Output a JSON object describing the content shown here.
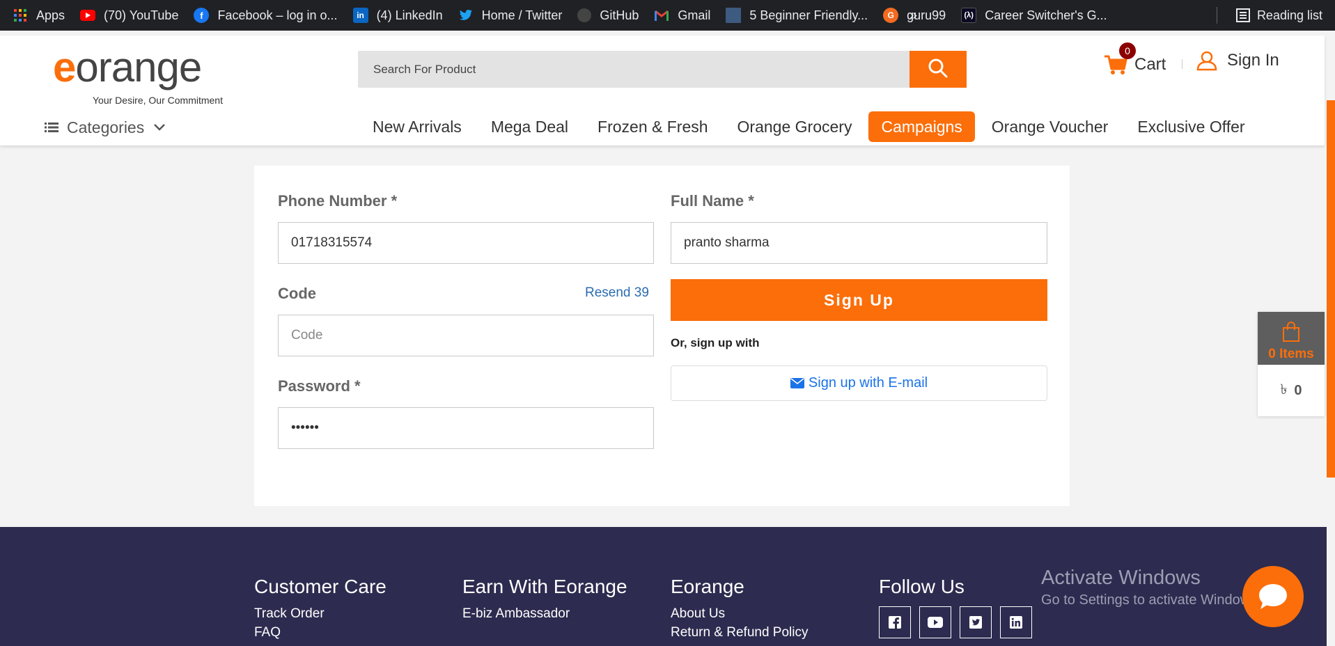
{
  "bookmarks": [
    {
      "label": "Apps",
      "icon": "apps-grid-icon"
    },
    {
      "label": "(70) YouTube",
      "icon": "youtube-icon"
    },
    {
      "label": "Facebook – log in o...",
      "icon": "facebook-icon"
    },
    {
      "label": "(4) LinkedIn",
      "icon": "linkedin-icon"
    },
    {
      "label": "Home / Twitter",
      "icon": "twitter-icon"
    },
    {
      "label": "GitHub",
      "icon": "github-icon"
    },
    {
      "label": "Gmail",
      "icon": "gmail-icon"
    },
    {
      "label": "5 Beginner Friendly...",
      "icon": "article-thumbnail-icon"
    },
    {
      "label": "guru99",
      "icon": "guru99-icon"
    },
    {
      "label": "Career Switcher's G...",
      "icon": "freecodecamp-icon"
    }
  ],
  "bookmarks_more": "»",
  "reading_list": "Reading list",
  "header": {
    "logo_e": "e",
    "logo_rest": "orange",
    "tagline": "Your Desire, Our Commitment",
    "search_placeholder": "Search For Product",
    "cart_count": "0",
    "cart_label": "Cart",
    "signin_label": "Sign In",
    "categories_label": "Categories"
  },
  "nav": [
    {
      "label": "New Arrivals",
      "active": false
    },
    {
      "label": "Mega Deal",
      "active": false
    },
    {
      "label": "Frozen & Fresh",
      "active": false
    },
    {
      "label": "Orange Grocery",
      "active": false
    },
    {
      "label": "Campaigns",
      "active": true
    },
    {
      "label": "Orange Voucher",
      "active": false
    },
    {
      "label": "Exclusive Offer",
      "active": false
    }
  ],
  "form": {
    "phone_label": "Phone Number *",
    "phone_value": "01718315574",
    "code_label": "Code",
    "resend_label": "Resend 39",
    "code_placeholder": "Code",
    "password_label": "Password *",
    "password_value": "••••••",
    "fullname_label": "Full Name *",
    "fullname_value": "pranto sharma",
    "signup_button": "Sign Up",
    "or_text": "Or, sign up with",
    "email_button": "Sign up with E-mail"
  },
  "mini_cart": {
    "items_label": "0 Items",
    "currency": "৳",
    "total": "0"
  },
  "footer": {
    "columns": [
      {
        "title": "Customer Care",
        "links": [
          "Track Order",
          "FAQ"
        ]
      },
      {
        "title": "Earn With Eorange",
        "links": [
          "E-biz Ambassador"
        ]
      },
      {
        "title": "Eorange",
        "links": [
          "About Us",
          "Return & Refund Policy"
        ]
      }
    ],
    "follow_title": "Follow Us",
    "socials": [
      "facebook-icon",
      "youtube-icon",
      "twitter-icon",
      "linkedin-icon"
    ]
  },
  "activate_windows": {
    "title": "Activate Windows",
    "subtitle": "Go to Settings to activate Windows."
  },
  "colors": {
    "brand_orange": "#fb6e0a",
    "footer_bg": "#2d2b4f",
    "link_blue": "#1a73e8"
  }
}
